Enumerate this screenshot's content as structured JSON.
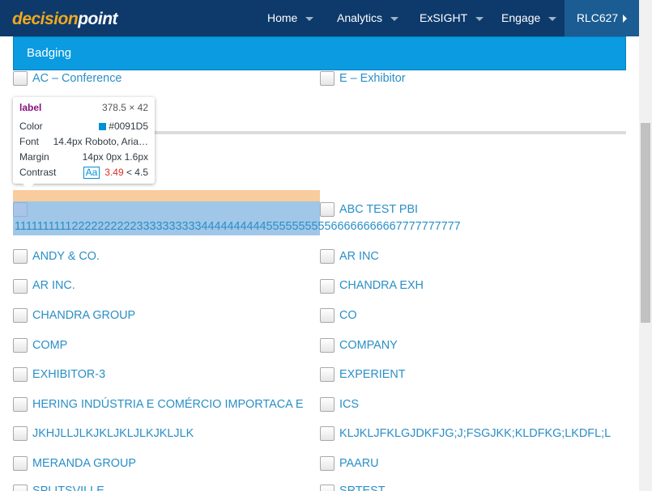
{
  "logo": {
    "part1": "decision",
    "part2": "point"
  },
  "nav": {
    "items": [
      "Home",
      "Analytics",
      "ExSIGHT",
      "Engage"
    ],
    "account": "RLC627"
  },
  "panel": {
    "title": "Badging"
  },
  "top_checkboxes": [
    "AC – Conference",
    "E – Exhibitor"
  ],
  "tooltip": {
    "tag": "label",
    "size": "378.5 × 42",
    "color_label": "Color",
    "color_value": "#0091D5",
    "font_label": "Font",
    "font_value": "14.4px Roboto, Aria…",
    "margin_label": "Margin",
    "margin_value": "14px 0px 1.6px",
    "contrast_label": "Contrast",
    "contrast_aa": "Aa",
    "contrast_ratio": "3.49",
    "contrast_target": "< 4.5"
  },
  "company_list": [
    "1111111111222222222233333333334444444444555555555566666666667777777777",
    "ABC TEST PBI",
    "ANDY & CO.",
    "AR INC",
    "AR INC.",
    "CHANDRA EXH",
    "CHANDRA GROUP",
    "CO",
    "COMP",
    "COMPANY",
    "EXHIBITOR-3",
    "EXPERIENT",
    "HERING INDÚSTRIA E COMÉRCIO IMPORTACA E",
    "ICS",
    "JKHJLLJLKJKLJKLJLKJKLJLK",
    "KLJKLJFKLGJDKFJG;J;FSGJKK;KLDFKG;LKDFL;L",
    "MERANDA GROUP",
    "PAARU",
    "SPLITSVILLE",
    "SRTEST"
  ],
  "colors": {
    "nav_bg": "#0d3a6b",
    "header_bg": "#0a9be1",
    "label_color": "#0091D5",
    "logo_accent": "#f2a81d"
  }
}
